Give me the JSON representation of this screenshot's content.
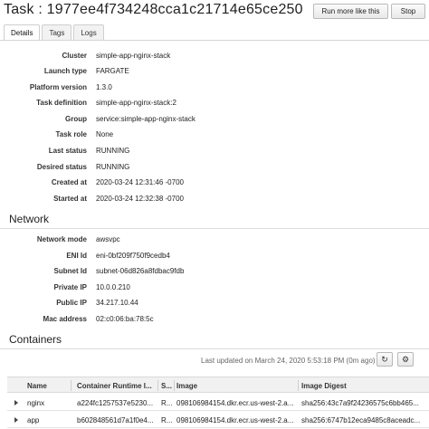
{
  "header": {
    "title": "Task : 1977ee4f734248cca1c21714e65ce250",
    "run_more_label": "Run more like this",
    "stop_label": "Stop"
  },
  "tabs": [
    {
      "label": "Details",
      "active": true
    },
    {
      "label": "Tags",
      "active": false
    },
    {
      "label": "Logs",
      "active": false
    }
  ],
  "details": {
    "cluster": {
      "label": "Cluster",
      "value": "simple-app-nginx-stack"
    },
    "launch_type": {
      "label": "Launch type",
      "value": "FARGATE"
    },
    "platform_version": {
      "label": "Platform version",
      "value": "1.3.0"
    },
    "task_definition": {
      "label": "Task definition",
      "value": "simple-app-nginx-stack:2"
    },
    "group": {
      "label": "Group",
      "value": "service:simple-app-nginx-stack"
    },
    "task_role": {
      "label": "Task role",
      "value": "None"
    },
    "last_status": {
      "label": "Last status",
      "value": "RUNNING"
    },
    "desired_status": {
      "label": "Desired status",
      "value": "RUNNING"
    },
    "created_at": {
      "label": "Created at",
      "value": "2020-03-24 12:31:46 -0700"
    },
    "started_at": {
      "label": "Started at",
      "value": "2020-03-24 12:32:38 -0700"
    }
  },
  "network": {
    "title": "Network",
    "network_mode": {
      "label": "Network mode",
      "value": "awsvpc"
    },
    "eni_id": {
      "label": "ENI Id",
      "value": "eni-0bf209f750f9cedb4"
    },
    "subnet_id": {
      "label": "Subnet Id",
      "value": "subnet-06d826a8fdbac9fdb"
    },
    "private_ip": {
      "label": "Private IP",
      "value": "10.0.0.210"
    },
    "public_ip": {
      "label": "Public IP",
      "value": "34.217.10.44"
    },
    "mac_address": {
      "label": "Mac address",
      "value": "02:c0:06:ba:78:5c"
    }
  },
  "containers": {
    "title": "Containers",
    "last_updated": "Last updated on March 24, 2020 5:53:18 PM (0m ago)",
    "refresh_icon": "refresh-icon",
    "settings_icon": "gear-icon",
    "columns": [
      "Name",
      "Container Runtime I...",
      "S...",
      "Image",
      "Image Digest"
    ],
    "rows": [
      {
        "name": "nginx",
        "runtime_id": "a224fc1257537e5230...",
        "status": "R...",
        "image": "098106984154.dkr.ecr.us-west-2.a...",
        "digest": "sha256:43c7a9f24236575c6bb465..."
      },
      {
        "name": "app",
        "runtime_id": "b602848561d7a1f0e4...",
        "status": "R...",
        "image": "098106984154.dkr.ecr.us-west-2.a...",
        "digest": "sha256:6747b12eca9485c8aceadc..."
      }
    ]
  },
  "colors": {
    "link": "#1166bb",
    "running": "#1d8102"
  }
}
